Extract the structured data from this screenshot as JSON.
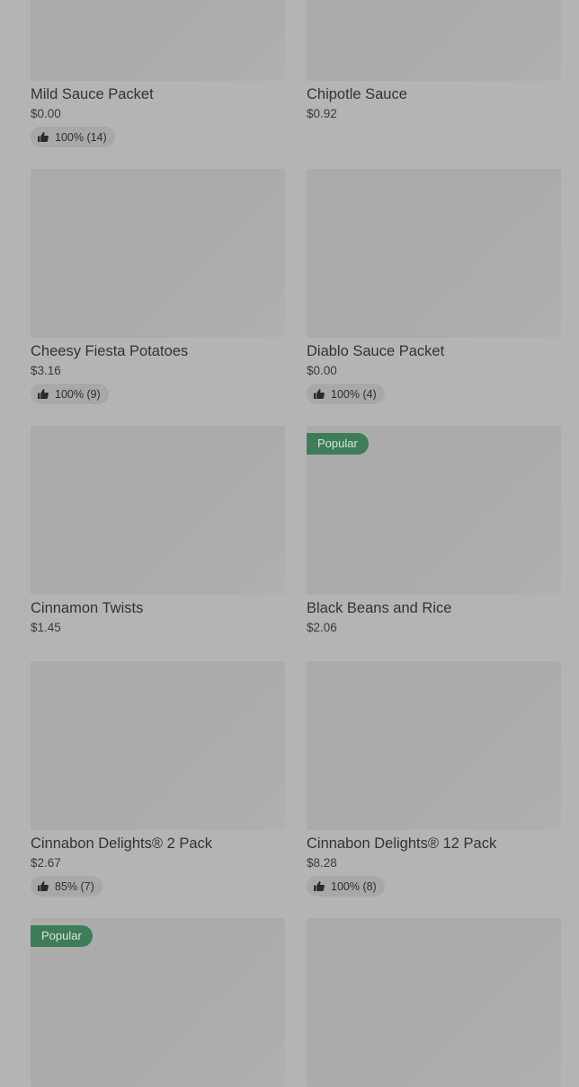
{
  "products": [
    {
      "name": "Mild Sauce Packet",
      "price": "$0.00",
      "rating": "100% (14)",
      "badge": ""
    },
    {
      "name": "Chipotle Sauce",
      "price": "$0.92",
      "rating": "",
      "badge": ""
    },
    {
      "name": "Cheesy Fiesta Potatoes",
      "price": "$3.16",
      "rating": "100% (9)",
      "badge": ""
    },
    {
      "name": "Diablo Sauce Packet",
      "price": "$0.00",
      "rating": "100% (4)",
      "badge": ""
    },
    {
      "name": "Cinnamon Twists",
      "price": "$1.45",
      "rating": "",
      "badge": ""
    },
    {
      "name": "Black Beans and Rice",
      "price": "$2.06",
      "rating": "",
      "badge": "Popular"
    },
    {
      "name": "Cinnabon Delights® 2 Pack",
      "price": "$2.67",
      "rating": "85% (7)",
      "badge": ""
    },
    {
      "name": "Cinnabon Delights® 12 Pack",
      "price": "$8.28",
      "rating": "100% (8)",
      "badge": ""
    },
    {
      "name": "",
      "price": "",
      "rating": "",
      "badge": "Popular"
    },
    {
      "name": "",
      "price": "",
      "rating": "",
      "badge": ""
    }
  ],
  "colors": {
    "badge": "#3f7c58",
    "overlay": "#b4b4b4",
    "image_placeholder": "#ababab"
  }
}
